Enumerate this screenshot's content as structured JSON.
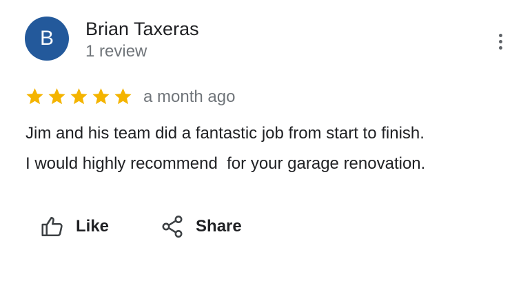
{
  "colors": {
    "avatar_bg": "#23599b",
    "star": "#f4b400",
    "text_primary": "#202124",
    "text_secondary": "#70757a",
    "icon": "#3c4043"
  },
  "review": {
    "author": {
      "initial": "B",
      "name": "Brian Taxeras",
      "review_count": "1 review"
    },
    "rating": 5,
    "max_rating": 5,
    "date": "a month ago",
    "text": "Jim and his team did a fantastic job from start to finish.\nI would highly recommend  for your garage renovation."
  },
  "actions": {
    "like_label": "Like",
    "like_icon": "thumbs-up-icon",
    "share_label": "Share",
    "share_icon": "share-icon"
  },
  "menu": {
    "icon": "more-vert-icon"
  }
}
